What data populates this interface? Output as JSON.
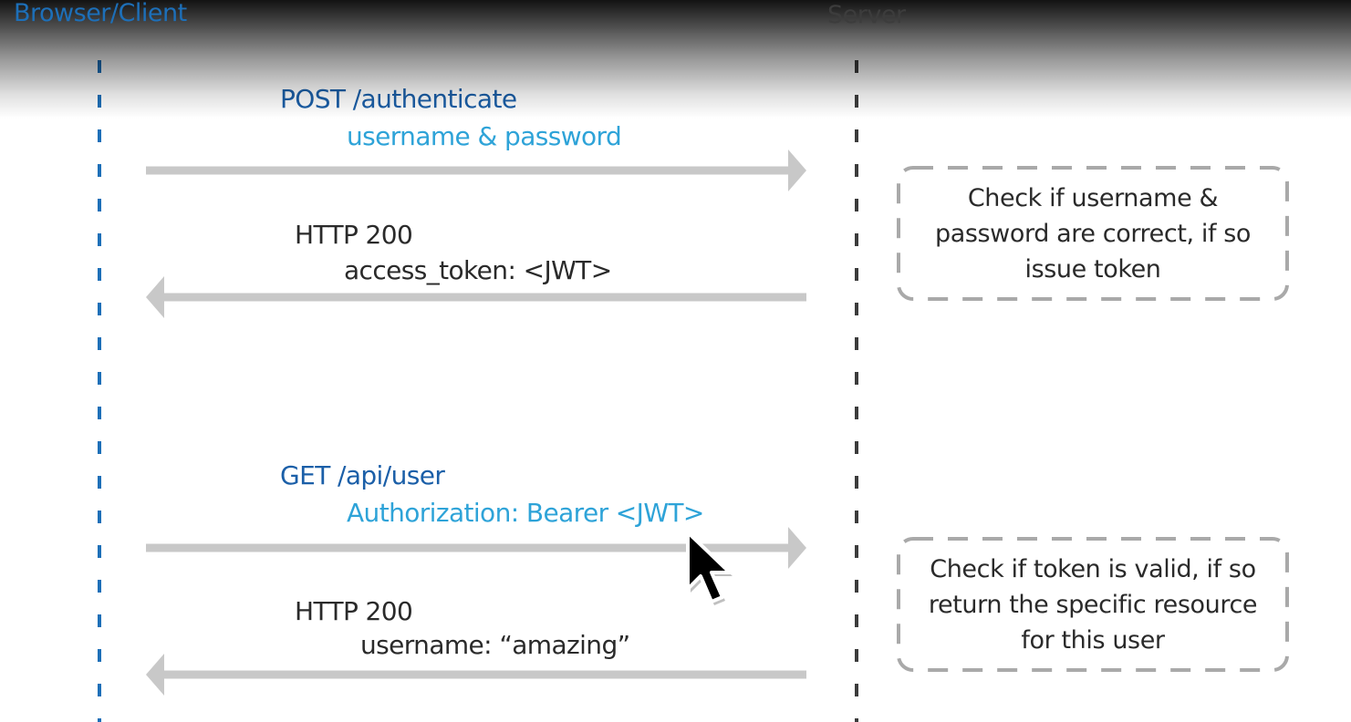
{
  "lanes": {
    "client": {
      "title": "Browser/Client",
      "color": "#1d6fb8"
    },
    "server": {
      "title": "Server",
      "color": "#3c3c3c"
    }
  },
  "messages": [
    {
      "label": "POST /authenticate",
      "detail": "username & password",
      "direction": "client-to-server"
    },
    {
      "label": "HTTP 200",
      "detail": "access_token: <JWT>",
      "direction": "server-to-client"
    },
    {
      "label": "GET /api/user",
      "detail": "Authorization: Bearer <JWT>",
      "direction": "client-to-server"
    },
    {
      "label": "HTTP 200",
      "detail": "username: “amazing”",
      "direction": "server-to-client"
    }
  ],
  "notes": [
    {
      "lines": [
        "Check if username &",
        "password are correct, if so",
        "issue token"
      ]
    },
    {
      "lines": [
        "Check if token is valid, if so",
        "return the specific resource",
        "for this user"
      ]
    }
  ],
  "colors": {
    "request_label": "#1b5fa8",
    "request_detail": "#2ea3d8",
    "response_text": "#2a2a2a",
    "arrow": "#c8c8c8",
    "note_border": "#a9a9a9"
  },
  "cursor": {
    "icon": "mouse-pointer-icon"
  }
}
